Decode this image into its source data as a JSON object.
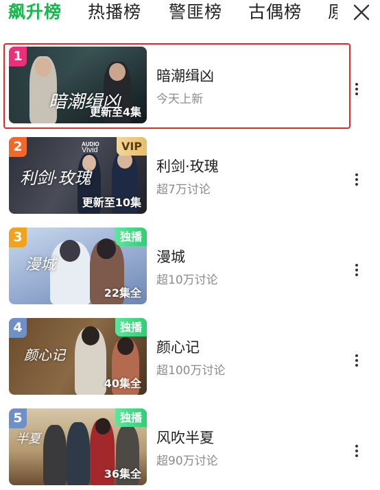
{
  "tabs": [
    {
      "label": "飙升榜",
      "active": true
    },
    {
      "label": "热播榜",
      "active": false
    },
    {
      "label": "警匪榜",
      "active": false
    },
    {
      "label": "古偶榜",
      "active": false
    },
    {
      "label": "原",
      "active": false
    }
  ],
  "close_icon": "close-icon",
  "accent_color": "#16b84d",
  "items": [
    {
      "rank": "1",
      "rank_color": "#e9307a",
      "title": "暗潮缉凶",
      "subtitle": "今天上新",
      "status": "更新至4集",
      "tag": "",
      "overlay_title": "暗潮缉凶",
      "selected": true
    },
    {
      "rank": "2",
      "rank_color": "#ef6a2a",
      "title": "利剑·玫瑰",
      "subtitle": "超7万讨论",
      "status": "更新至10集",
      "tag": "VIP",
      "audio_badge": [
        "AUDIO",
        "Vivid"
      ],
      "overlay_title": "利剑·玫瑰",
      "selected": false
    },
    {
      "rank": "3",
      "rank_color": "#f1a21e",
      "title": "漫城",
      "subtitle": "超10万讨论",
      "status": "22集全",
      "tag": "独播",
      "overlay_title": "漫城",
      "selected": false
    },
    {
      "rank": "4",
      "rank_color": "#6f8fc7",
      "title": "颜心记",
      "subtitle": "超100万讨论",
      "status": "40集全",
      "tag": "独播",
      "overlay_title": "颜心记",
      "selected": false
    },
    {
      "rank": "5",
      "rank_color": "#6f8fc7",
      "title": "风吹半夏",
      "subtitle": "超90万讨论",
      "status": "36集全",
      "tag": "独播",
      "overlay_title": "半夏",
      "selected": false
    }
  ]
}
